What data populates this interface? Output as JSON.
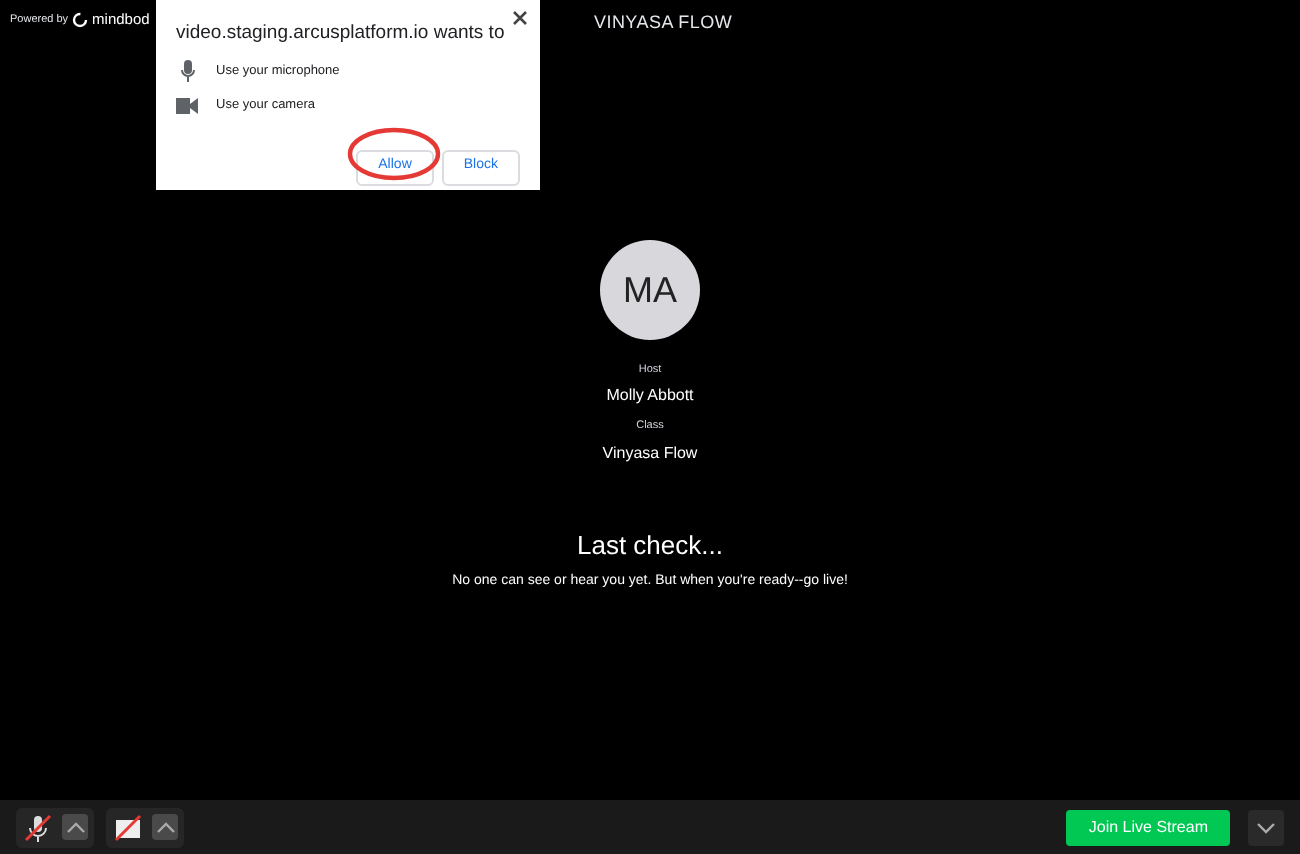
{
  "header": {
    "powered_by": "Powered by",
    "brand": "mindbod",
    "title": "VINYASA FLOW"
  },
  "permission_popup": {
    "title": "video.staging.arcusplatform.io wants to",
    "items": [
      {
        "kind": "microphone",
        "label": "Use your microphone"
      },
      {
        "kind": "camera",
        "label": "Use your camera"
      }
    ],
    "buttons": [
      {
        "label": "Allow",
        "highlighted": true
      },
      {
        "label": "Block",
        "highlighted": false
      }
    ]
  },
  "host": {
    "initials": "MA",
    "host_label": "Host",
    "host_name": "Molly Abbott",
    "class_label": "Class",
    "class_name": "Vinyasa Flow"
  },
  "message": {
    "heading": "Last check...",
    "text": "No one can see or hear you yet. But when you're ready--go live!"
  },
  "controls": [
    {
      "kind": "microphone",
      "muted": true
    },
    {
      "kind": "camera",
      "muted": true
    }
  ],
  "join_button": "Join Live Stream"
}
